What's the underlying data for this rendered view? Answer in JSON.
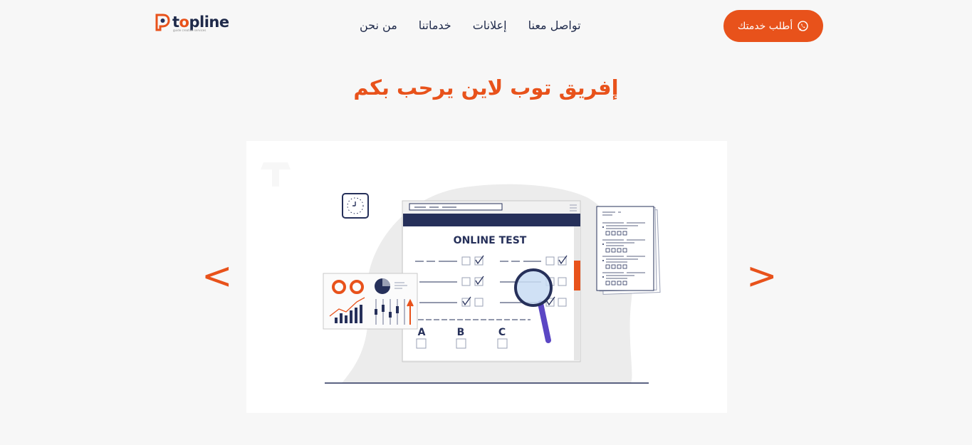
{
  "brand": {
    "name_prefix": "t",
    "name_o": "o",
    "name_suffix": "pline",
    "tagline": "guide creative services"
  },
  "nav": {
    "items": [
      {
        "id": "contact",
        "label": "تواصل معنا"
      },
      {
        "id": "ads",
        "label": "إعلانات"
      },
      {
        "id": "services",
        "label": "خدماتنا"
      },
      {
        "id": "about",
        "label": "من نحن"
      }
    ]
  },
  "cta": {
    "label": "أطلب خدمتك",
    "icon": "whatsapp-icon"
  },
  "hero": {
    "title": "إفريق توب لاين يرحب بكم"
  },
  "slider": {
    "prev_label": "<",
    "next_label": ">",
    "illustration": {
      "test_title": "ONLINE TEST",
      "options": [
        "A",
        "B",
        "C"
      ]
    }
  },
  "colors": {
    "accent": "#e8521b",
    "navy": "#26305a",
    "background": "#f7f7f7"
  }
}
